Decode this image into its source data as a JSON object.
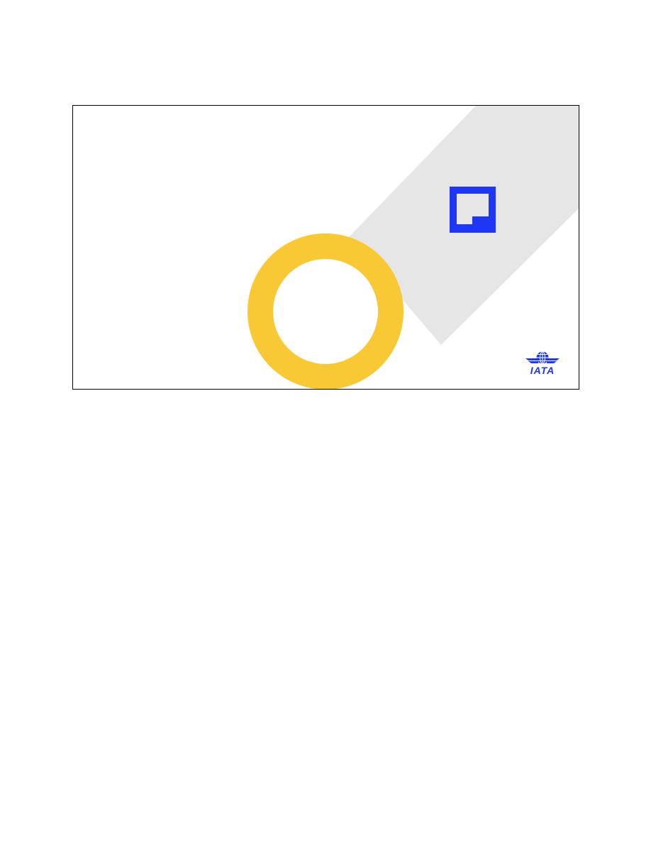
{
  "slide": {
    "logo": {
      "icon": "iata-globe-wings-icon",
      "text": "IATA"
    },
    "colors": {
      "accent_band": "#e6e6e6",
      "ring": "#f9c835",
      "square": "#1f36f5",
      "logo": "#1f36f5",
      "frame_border": "#000000",
      "background": "#ffffff"
    }
  }
}
